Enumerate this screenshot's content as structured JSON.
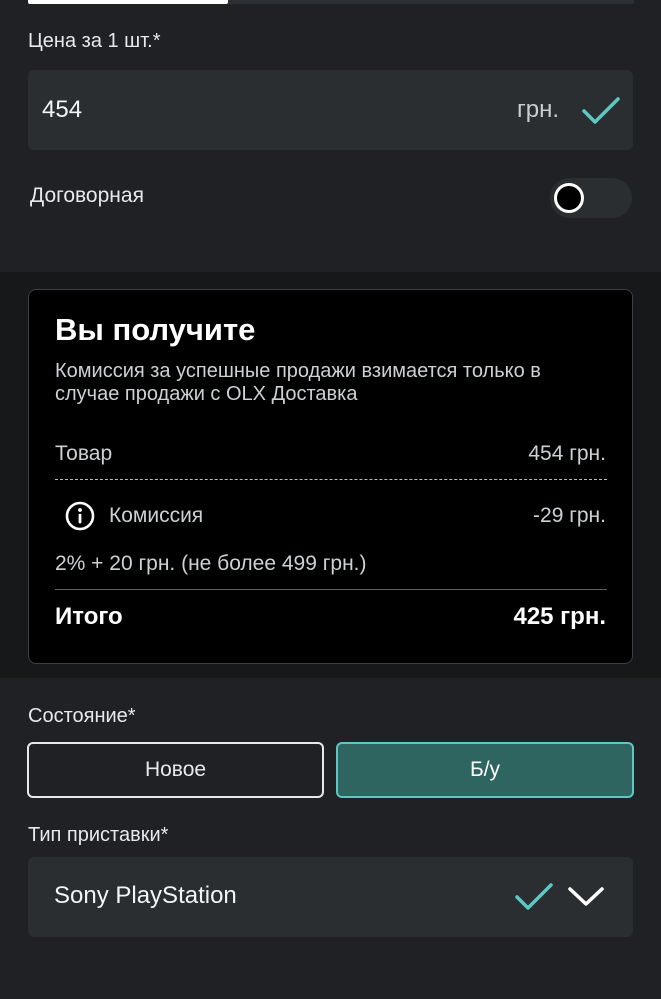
{
  "price": {
    "label": "Цена за 1 шт.*",
    "value": "454",
    "unit": "грн."
  },
  "negotiable": {
    "label": "Договорная",
    "enabled": false
  },
  "summary": {
    "title": "Вы получите",
    "description": "Комиссия за успешные продажи взимается только в случае продажи с OLX Доставка",
    "item_label": "Товар",
    "item_value": "454 грн.",
    "commission_label": "Комиссия",
    "commission_value": "-29 грн.",
    "commission_note": "2% + 20 грн. (не более 499 грн.)",
    "total_label": "Итого",
    "total_value": "425 грн."
  },
  "condition": {
    "label": "Состояние*",
    "options": [
      "Новое",
      "Б/у"
    ],
    "selected": "Б/у"
  },
  "console_type": {
    "label": "Тип приставки*",
    "value": "Sony PlayStation"
  },
  "colors": {
    "accent": "#5ec7c4",
    "selected_fill": "#2e6561",
    "background": "#1f2124",
    "field": "#2b2e31",
    "card": "#000000"
  }
}
